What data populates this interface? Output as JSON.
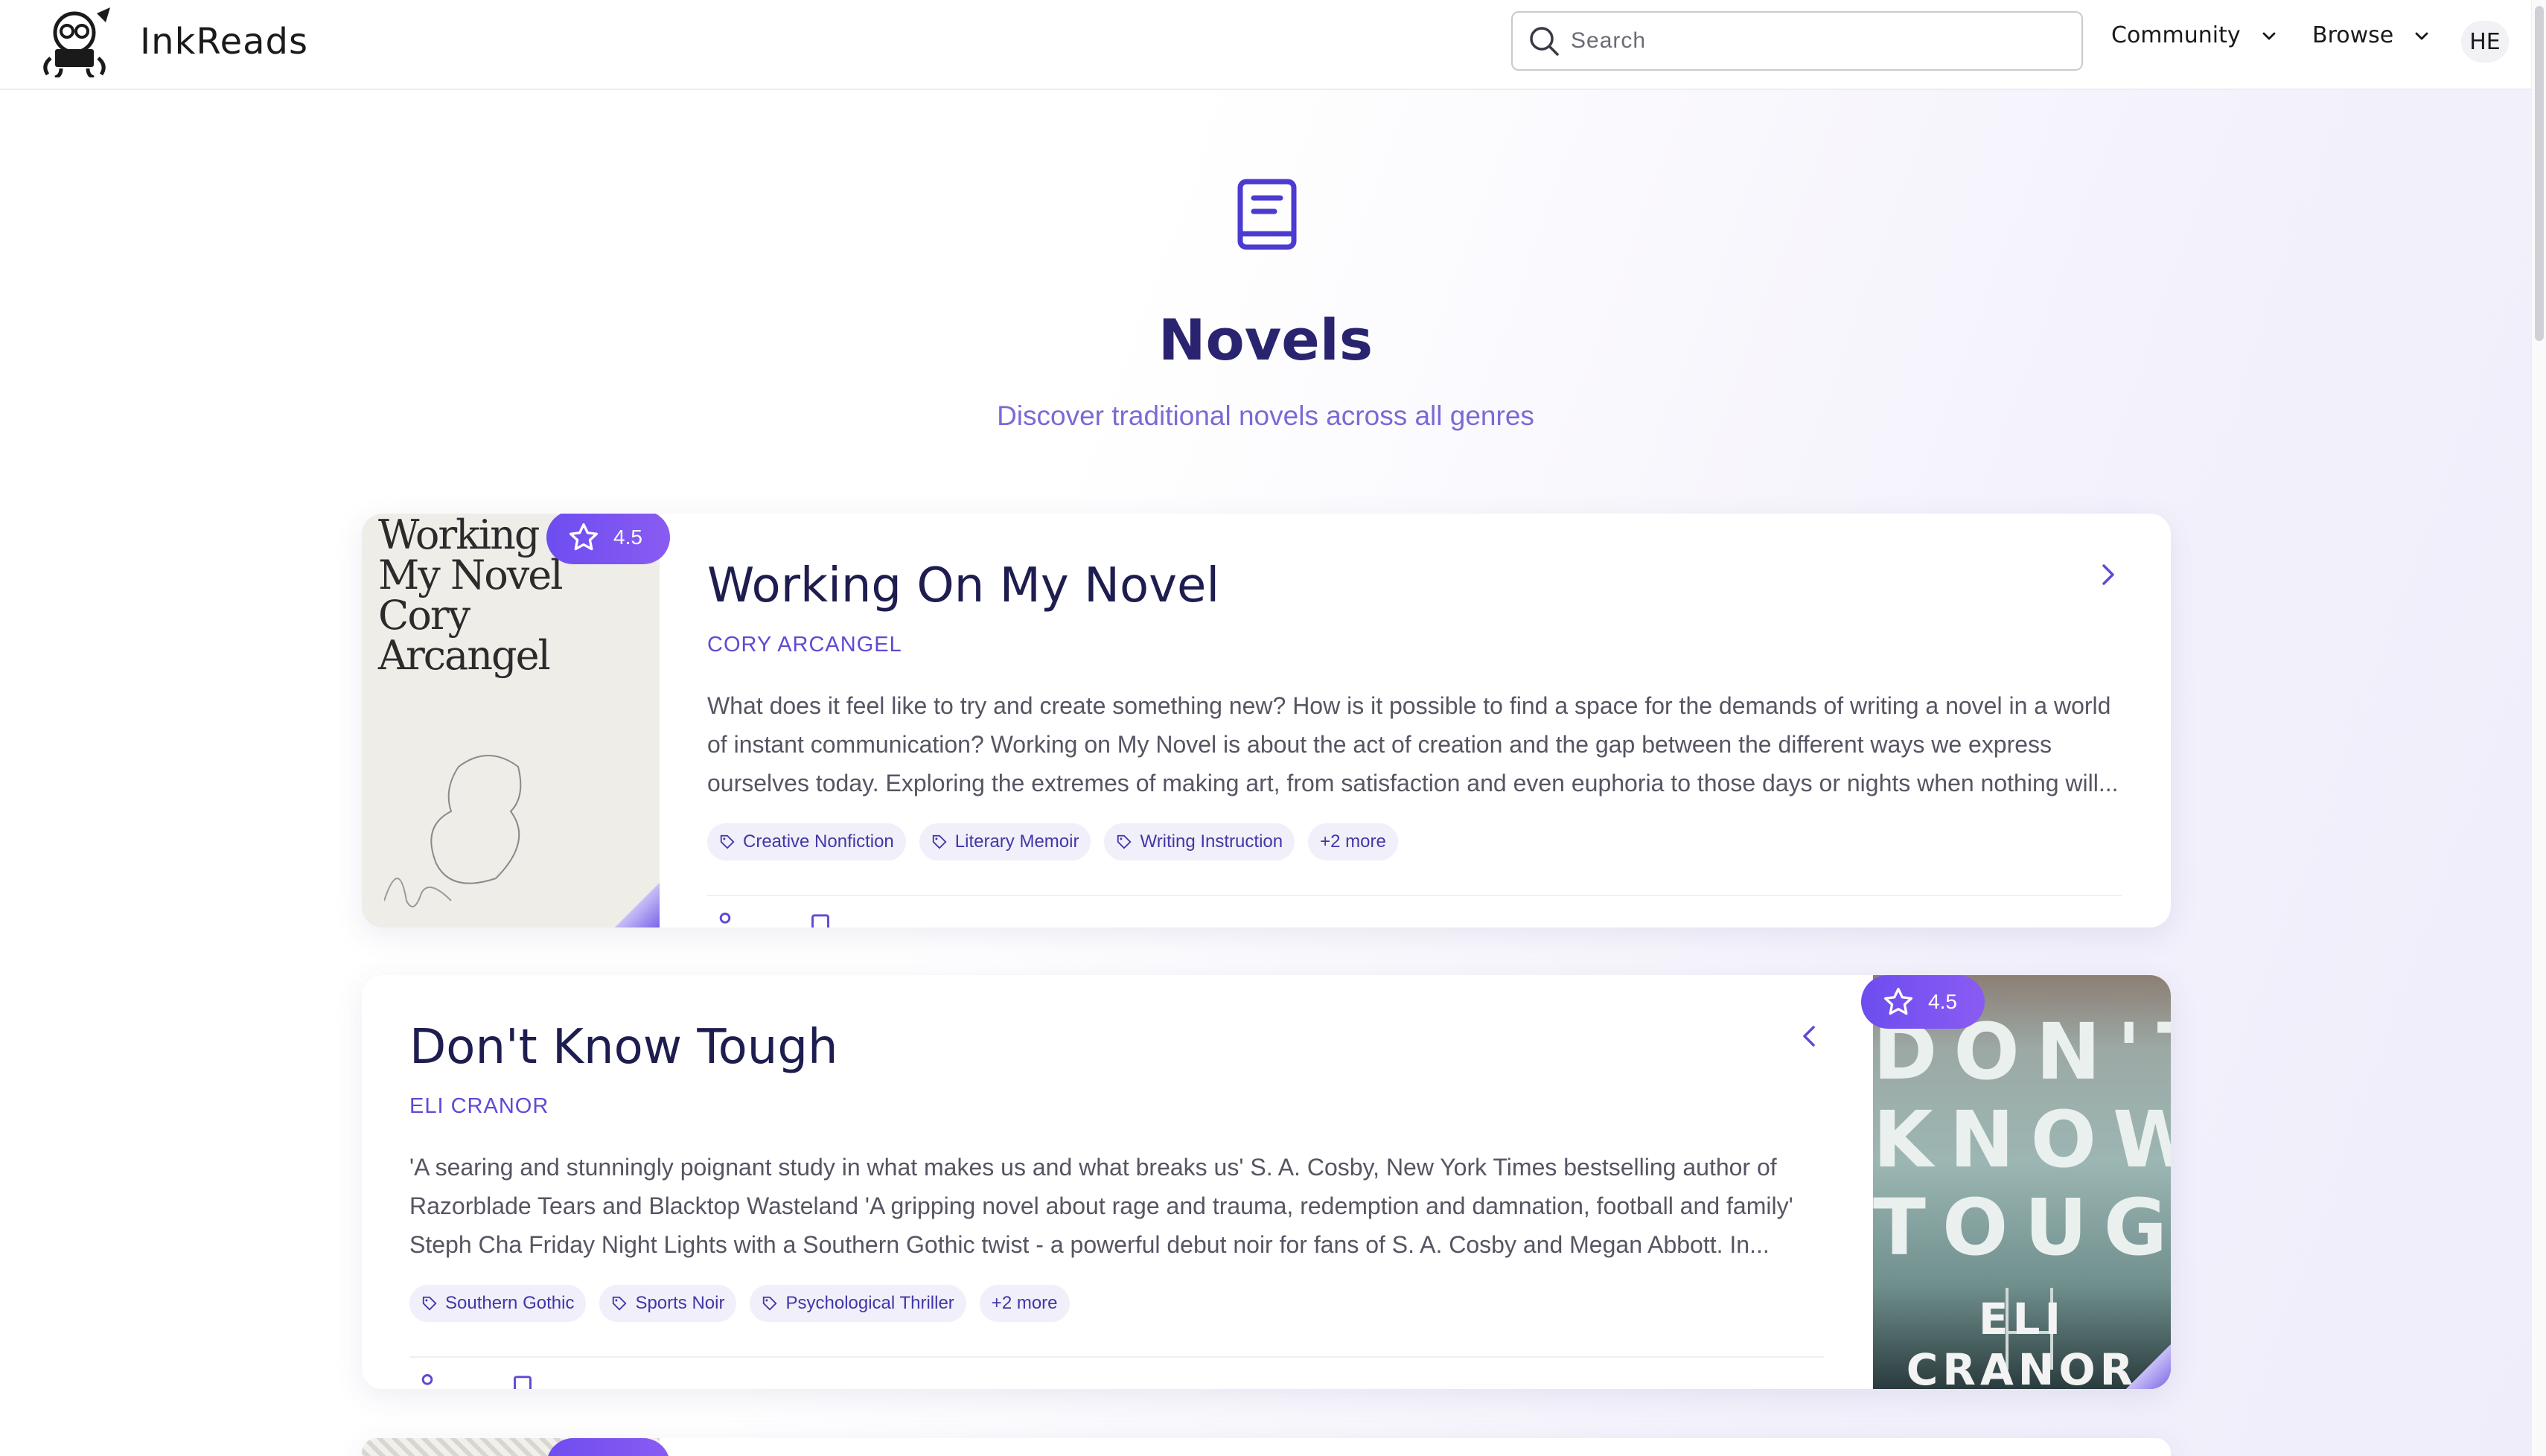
{
  "app": {
    "name": "InkReads"
  },
  "header": {
    "search_placeholder": "Search",
    "nav": [
      {
        "label": "Community"
      },
      {
        "label": "Browse"
      }
    ],
    "avatar_initials": "HE"
  },
  "hero": {
    "title": "Novels",
    "subtitle": "Discover traditional novels across all genres"
  },
  "books": [
    {
      "title": "Working On My Novel",
      "author": "CORY ARCANGEL",
      "rating": "4.5",
      "description": "What does it feel like to try and create something new? How is it possible to find a space for the demands of writing a novel in a world of instant communication? Working on My Novel is about the act of creation and the gap between the different ways we express ourselves today. Exploring the extremes of making art, from satisfaction and even euphoria to those days or nights when nothing will...",
      "tags": [
        "Creative Nonfiction",
        "Literary Memoir",
        "Writing Instruction",
        "+2 more"
      ],
      "cover_text": [
        "Working",
        "My Novel",
        "Cory",
        "Arcangel"
      ]
    },
    {
      "title": "Don't Know Tough",
      "author": "ELI CRANOR",
      "rating": "4.5",
      "description": "'A searing and stunningly poignant study in what makes us and what breaks us' S. A. Cosby, New York Times bestselling author of Razorblade Tears and Blacktop Wasteland 'A gripping novel about rage and trauma, redemption and damnation, football and family' Steph Cha Friday Night Lights with a Southern Gothic twist - a powerful debut noir for fans of S. A. Cosby and Megan Abbott. In...",
      "tags": [
        "Southern Gothic",
        "Sports Noir",
        "Psychological Thriller",
        "+2 more"
      ],
      "cover_text": [
        "DON'T",
        "KNOW",
        "TOUGH"
      ],
      "cover_author": "ELI CRANOR"
    }
  ]
}
